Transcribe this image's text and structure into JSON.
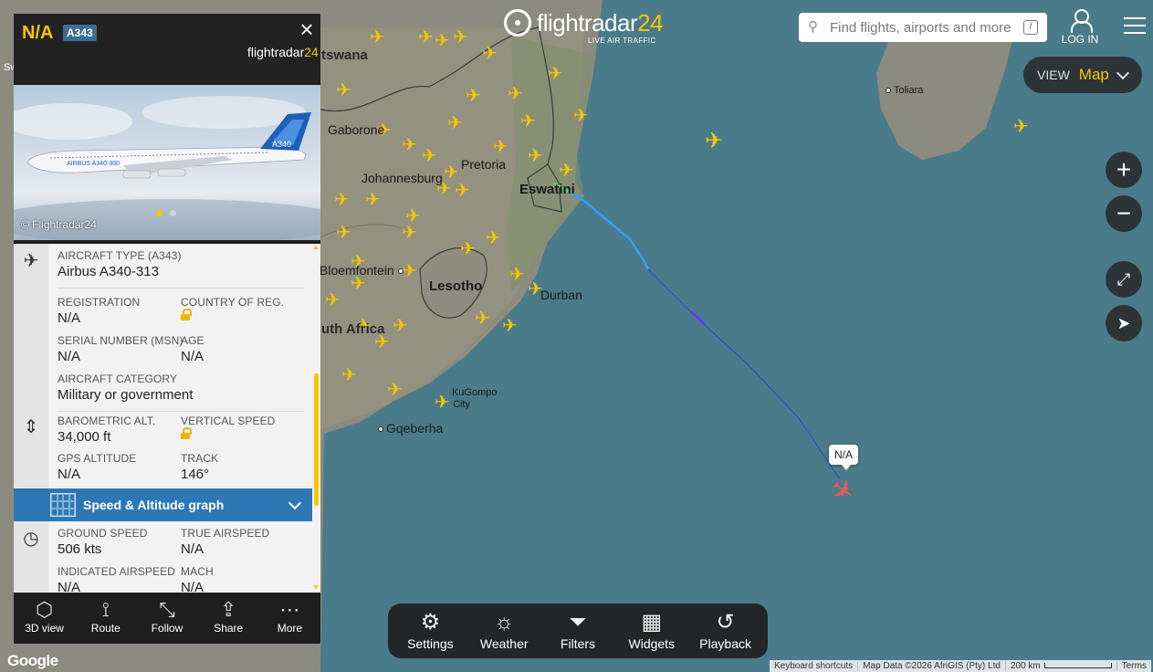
{
  "header": {
    "logo_text": "flightradar",
    "logo_num": "24",
    "logo_sub": "LIVE AIR TRAFFIC",
    "search_placeholder": "Find flights, airports and more",
    "search_shortcut": "/",
    "login_label": "LOG IN"
  },
  "view": {
    "label": "VIEW",
    "value": "Map"
  },
  "map_controls": {
    "zoom_in": "+",
    "zoom_out": "−"
  },
  "map": {
    "labels": {
      "botswana": "tswana",
      "gaborone": "Gaborone",
      "johannesburg": "Johannesburg",
      "pretoria": "Pretoria",
      "eswatini": "Eswatini",
      "bloemfontein": "Bloemfontein",
      "lesotho": "Lesotho",
      "durban": "Durban",
      "south_africa": "uth Africa",
      "kugompo": "KuGompo",
      "kugompo_city": "City",
      "gqeberha": "Gqeberha",
      "toliara": "Toliara",
      "sw": "Sw"
    },
    "selected_flight_tag": "N/A"
  },
  "panel": {
    "callsign": "N/A",
    "type_badge": "A343",
    "brand_text": "flightradar",
    "brand_num": "24",
    "photo_credit": "© Flightradar24",
    "photo_livery_text": "AIRBUS A340-300",
    "photo_tail": "A340",
    "aircraft_type_label": "AIRCRAFT TYPE",
    "aircraft_type_code": "(A343)",
    "aircraft_type_value": "Airbus A340-313",
    "registration_label": "REGISTRATION",
    "registration_value": "N/A",
    "country_label": "COUNTRY OF REG.",
    "msn_label": "SERIAL NUMBER (MSN)",
    "msn_value": "N/A",
    "age_label": "AGE",
    "age_value": "N/A",
    "category_label": "AIRCRAFT CATEGORY",
    "category_value": "Military or government",
    "baro_label": "BAROMETRIC ALT.",
    "baro_value": "34,000 ft",
    "vspeed_label": "VERTICAL SPEED",
    "gps_label": "GPS ALTITUDE",
    "gps_value": "N/A",
    "track_label": "TRACK",
    "track_value": "146°",
    "graph_label": "Speed & Altitude graph",
    "ground_speed_label": "GROUND SPEED",
    "ground_speed_value": "506 kts",
    "tas_label": "TRUE AIRSPEED",
    "tas_value": "N/A",
    "ias_label": "INDICATED AIRSPEED",
    "ias_value": "N/A",
    "mach_label": "MACH",
    "mach_value": "N/A"
  },
  "panel_footer": [
    {
      "label": "3D view",
      "icon": "cube-icon"
    },
    {
      "label": "Route",
      "icon": "route-icon"
    },
    {
      "label": "Follow",
      "icon": "follow-icon"
    },
    {
      "label": "Share",
      "icon": "share-icon"
    },
    {
      "label": "More",
      "icon": "more-icon"
    }
  ],
  "toolbar": [
    {
      "label": "Settings",
      "icon": "gear-icon"
    },
    {
      "label": "Weather",
      "icon": "weather-icon"
    },
    {
      "label": "Filters",
      "icon": "filter-icon"
    },
    {
      "label": "Widgets",
      "icon": "widgets-icon"
    },
    {
      "label": "Playback",
      "icon": "playback-icon"
    }
  ],
  "footer": {
    "google": "Google",
    "keyboard": "Keyboard shortcuts",
    "map_data": "Map Data ©2026 AfriGIS (Pty) Ltd",
    "scale": "200 km",
    "terms": "Terms"
  },
  "colors": {
    "accent": "#f7c600",
    "ocean": "#4a7b8a",
    "land": "#8a8a7e",
    "graph_bar": "#2d78b4",
    "aircraft_selected": "#e85a5a"
  }
}
